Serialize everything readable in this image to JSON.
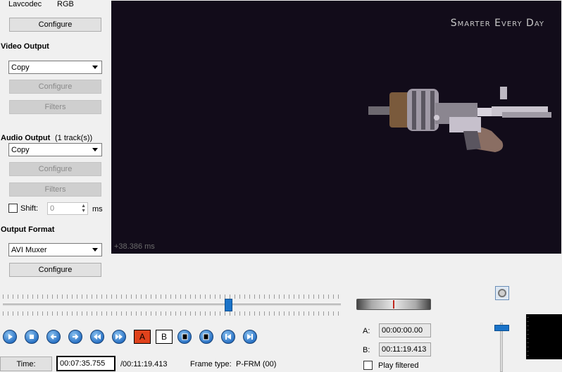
{
  "decoder": {
    "codec_label": "Lavcodec",
    "colorspace_label": "RGB",
    "configure_label": "Configure"
  },
  "video_output": {
    "heading": "Video Output",
    "codec": "Copy",
    "configure_label": "Configure",
    "filters_label": "Filters"
  },
  "audio_output": {
    "heading": "Audio Output",
    "tracks": "(1 track(s))",
    "codec": "Copy",
    "configure_label": "Configure",
    "filters_label": "Filters",
    "shift_label": "Shift:",
    "shift_value": "0",
    "shift_unit": "ms"
  },
  "output_format": {
    "heading": "Output Format",
    "muxer": "AVI Muxer",
    "configure_label": "Configure"
  },
  "preview": {
    "watermark": "Smarter Every Day",
    "offset": "+38.386 ms"
  },
  "timeline": {
    "position": 0.667
  },
  "markers": {
    "a_label": "A",
    "b_label": "B"
  },
  "selection": {
    "a_label": "A:",
    "a_value": "00:00:00.00",
    "b_label": "B:",
    "b_value": "00:11:19.413",
    "play_filtered_label": "Play filtered"
  },
  "status": {
    "time_button": "Time:",
    "current_time": "00:07:35.755",
    "total_time": "/00:11:19.413",
    "frame_type_label": "Frame type:",
    "frame_type_value": "P-FRM (00)"
  },
  "volume": {
    "level": 0.95
  },
  "icons": {
    "play": "play-icon",
    "stop": "stop-icon",
    "prev_frame": "arrow-left-icon",
    "next_frame": "arrow-right-icon",
    "rewind": "rewind-icon",
    "fast_forward": "fast-forward-icon",
    "prev_black": "prev-black-icon",
    "next_black": "next-black-icon",
    "first": "first-frame-icon",
    "last": "last-frame-icon",
    "speaker": "speaker-icon"
  },
  "colors": {
    "accent_blue": "#2b73c5",
    "marker_a_fill": "#e0421c",
    "video_bg": "#120c1a"
  }
}
